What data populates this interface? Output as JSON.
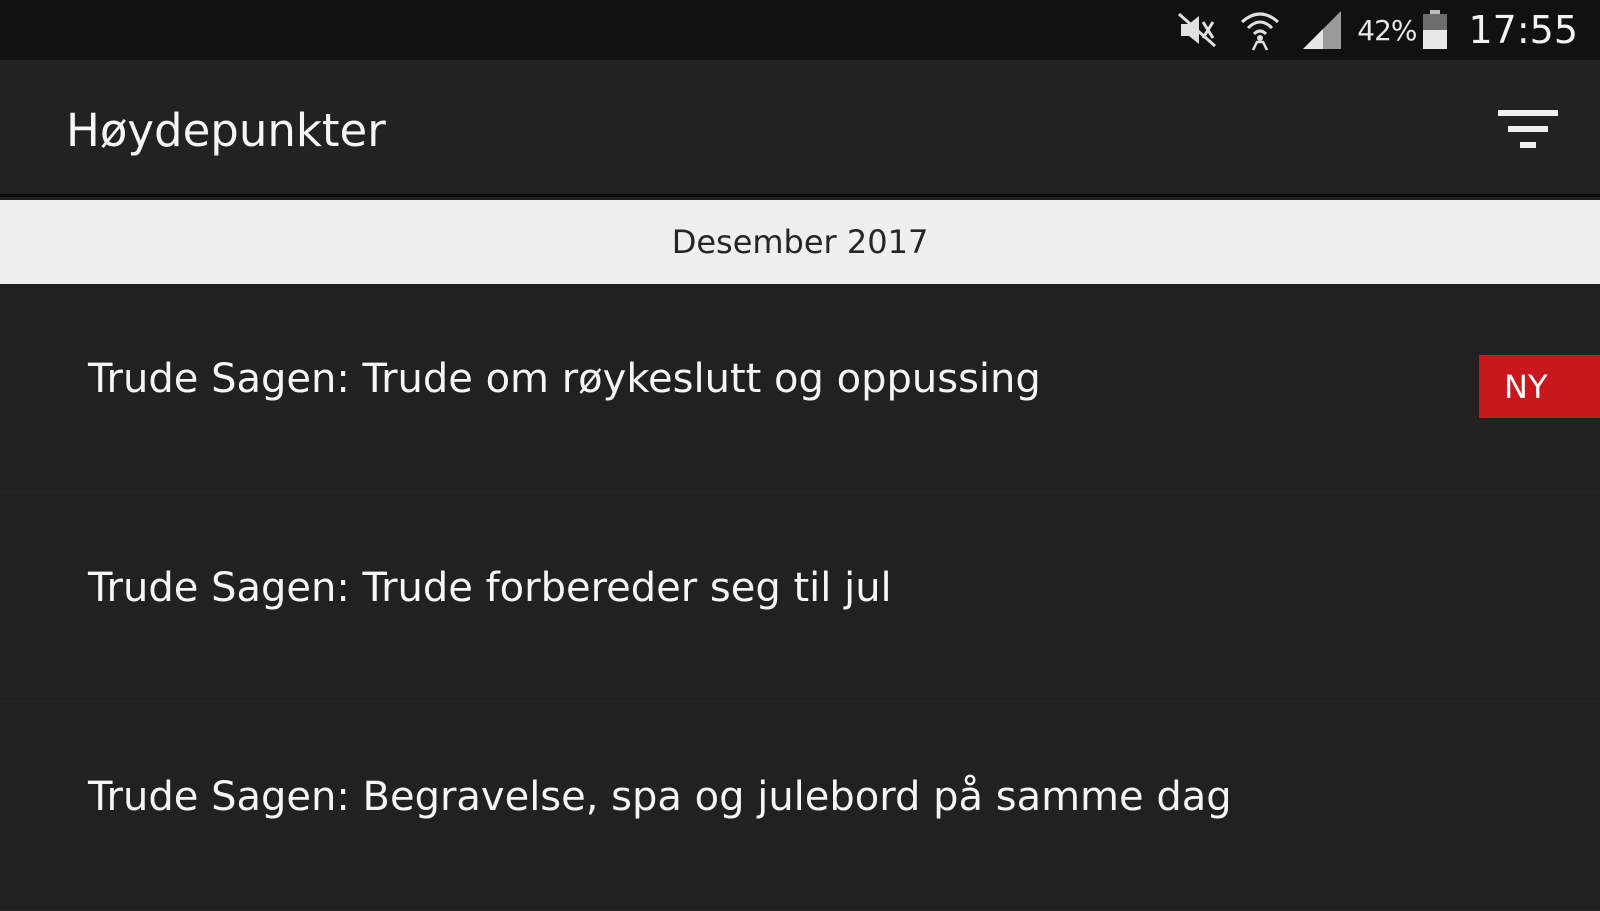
{
  "status_bar": {
    "icons": [
      "mute-icon",
      "wifi-icon",
      "signal-icon",
      "battery-icon"
    ],
    "battery_percent": "42%",
    "time": "17:55"
  },
  "app_bar": {
    "title": "Høydepunkter",
    "filter_icon": "filter-icon"
  },
  "section": {
    "header": "Desember 2017"
  },
  "items": [
    {
      "title": "Trude Sagen: Trude om røykeslutt og oppussing",
      "badge": "NY"
    },
    {
      "title": "Trude Sagen: Trude forbereder seg til jul"
    },
    {
      "title": "Trude Sagen: Begravelse, spa og julebord på samme dag"
    }
  ],
  "colors": {
    "background": "#212121",
    "status_bar": "#111111",
    "section_header_bg": "#efefef",
    "badge": "#c8181e"
  }
}
